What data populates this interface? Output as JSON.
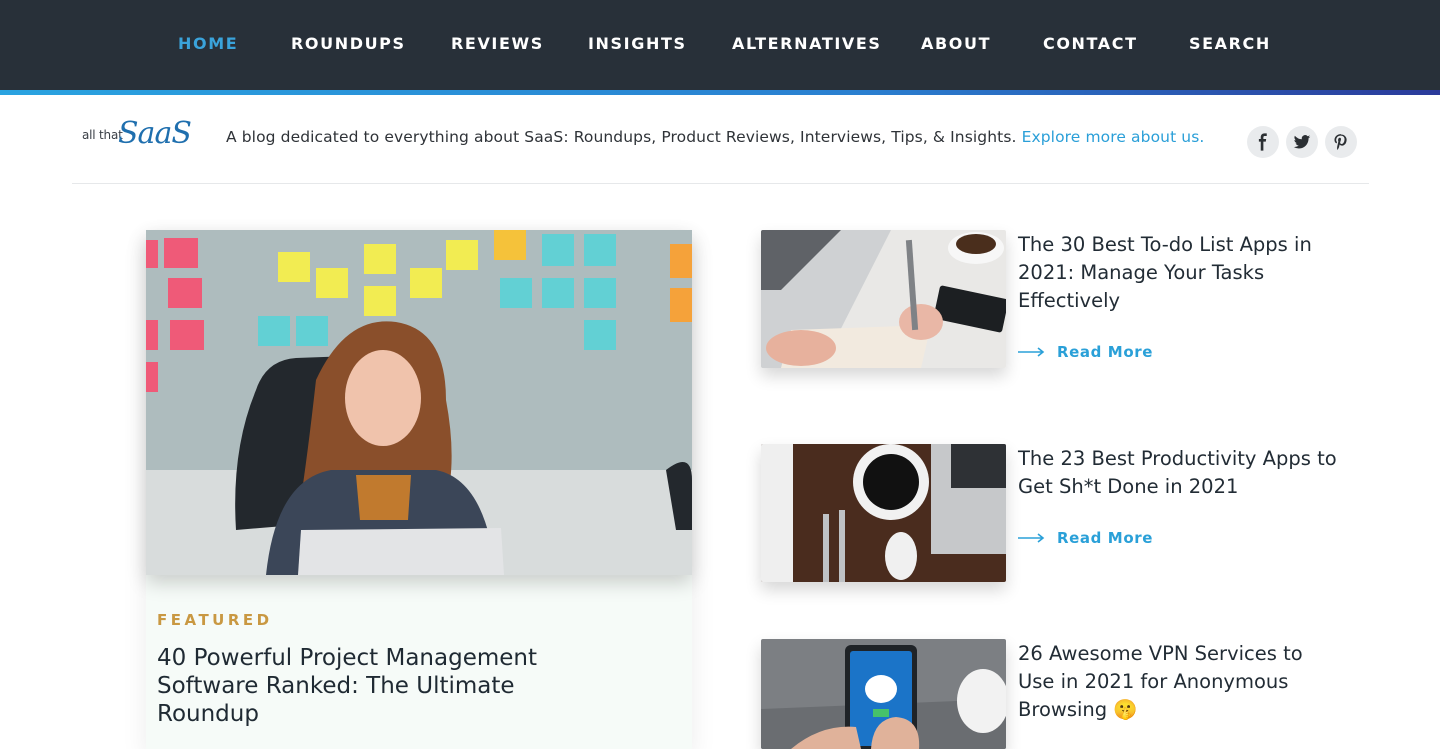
{
  "nav": {
    "items": [
      {
        "label": "HOME",
        "active": true
      },
      {
        "label": "ROUNDUPS",
        "active": false
      },
      {
        "label": "REVIEWS",
        "active": false
      },
      {
        "label": "INSIGHTS",
        "active": false
      },
      {
        "label": "ALTERNATIVES",
        "active": false
      },
      {
        "label": "ABOUT",
        "active": false
      },
      {
        "label": "CONTACT",
        "active": false
      },
      {
        "label": "SEARCH",
        "active": false
      }
    ]
  },
  "header": {
    "logo_small": "all that",
    "logo_script": "SaaS",
    "tagline": "A blog dedicated to everything about SaaS: Roundups, Product Reviews, Interviews, Tips, & Insights.",
    "tagline_link": "Explore more about us.",
    "social": [
      "facebook-icon",
      "twitter-icon",
      "pinterest-icon"
    ]
  },
  "featured": {
    "kicker": "FEATURED",
    "title": "40 Powerful Project Management Software Ranked: The Ultimate Roundup"
  },
  "posts": [
    {
      "title": "The 30 Best To-do List Apps in 2021: Manage Your Tasks Effectively",
      "read_more": "Read More"
    },
    {
      "title": "The 23 Best Productivity Apps to Get Sh*t Done in 2021",
      "read_more": "Read More"
    },
    {
      "title": "26 Awesome VPN Services to Use in 2021 for Anonymous Browsing 🤫"
    }
  ],
  "colors": {
    "nav_bg": "#283039",
    "accent": "#2aa0d8",
    "kicker": "#c99842"
  }
}
